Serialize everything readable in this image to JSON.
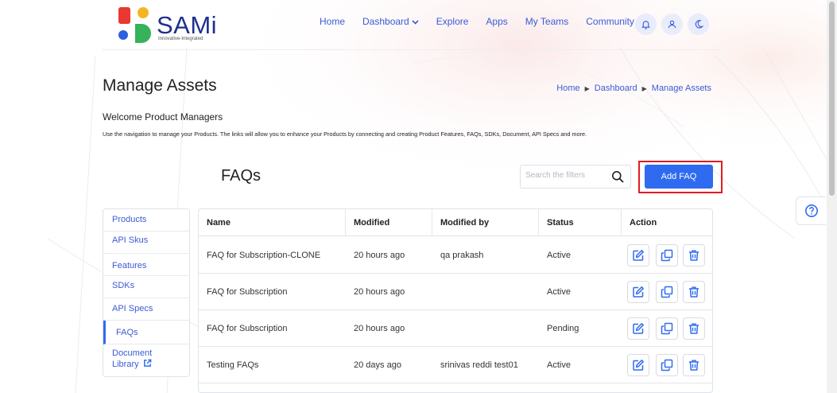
{
  "brand": {
    "name": "SAMi",
    "tagline": "Innovative-Integrated"
  },
  "nav": {
    "items": [
      {
        "label": "Home"
      },
      {
        "label": "Dashboard",
        "dropdown": true
      },
      {
        "label": "Explore"
      },
      {
        "label": "Apps"
      },
      {
        "label": "My Teams"
      },
      {
        "label": "Community",
        "dropdown": true
      }
    ],
    "icons": [
      "bell-icon",
      "user-icon",
      "moon-icon"
    ]
  },
  "page": {
    "title": "Manage Assets",
    "breadcrumb": [
      "Home",
      "Dashboard",
      "Manage Assets"
    ],
    "welcome": "Welcome Product Managers",
    "description": "Use the navigation to manage your Products. The links will allow you to enhance your Products by connecting and creating Product Features, FAQs, SDKs, Document, API Specs and more."
  },
  "faq": {
    "title": "FAQs",
    "search_placeholder": "Search the filters",
    "add_label": "Add FAQ"
  },
  "sidebar": {
    "items": [
      {
        "label": "Products"
      },
      {
        "label": "API Skus"
      },
      {
        "label": "Features"
      },
      {
        "label": "SDKs"
      },
      {
        "label": "API Specs"
      },
      {
        "label": "FAQs",
        "active": true
      },
      {
        "label": "Document"
      },
      {
        "label": "Library"
      }
    ]
  },
  "table": {
    "columns": [
      "Name",
      "Modified",
      "Modified by",
      "Status",
      "Action"
    ],
    "rows": [
      {
        "name": "FAQ for Subscription-CLONE",
        "modified": "20 hours ago",
        "modified_by": "qa prakash",
        "status": "Active"
      },
      {
        "name": "FAQ for Subscription",
        "modified": "20 hours ago",
        "modified_by": "",
        "status": "Active"
      },
      {
        "name": "FAQ for Subscription",
        "modified": "20 hours ago",
        "modified_by": "",
        "status": "Pending"
      },
      {
        "name": "Testing FAQs",
        "modified": "20 days ago",
        "modified_by": "srinivas reddi test01",
        "status": "Active"
      }
    ]
  },
  "colors": {
    "accent": "#2f6bf0",
    "link": "#3b5bd6",
    "highlight": "#e01b24"
  }
}
